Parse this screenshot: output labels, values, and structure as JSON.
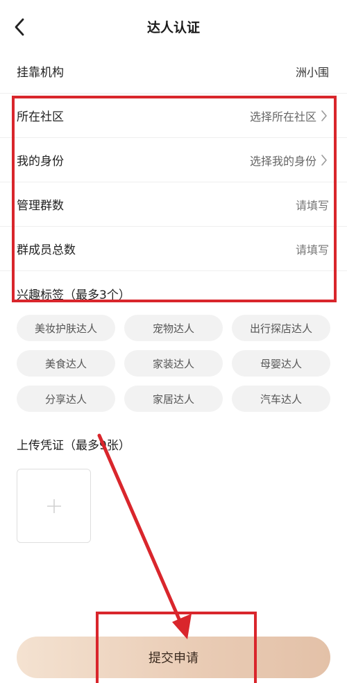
{
  "header": {
    "title": "达人认证",
    "back_icon": "chevron-left-icon"
  },
  "form": {
    "affiliation": {
      "label": "挂靠机构",
      "value": "洲小围"
    },
    "community": {
      "label": "所在社区",
      "value": "选择所在社区"
    },
    "identity": {
      "label": "我的身份",
      "value": "选择我的身份"
    },
    "groups_managed": {
      "label": "管理群数",
      "placeholder": "请填写"
    },
    "group_members": {
      "label": "群成员总数",
      "placeholder": "请填写"
    }
  },
  "interests": {
    "title": "兴趣标签（最多3个）",
    "tags": [
      "美妆护肤达人",
      "宠物达人",
      "出行探店达人",
      "美食达人",
      "家装达人",
      "母婴达人",
      "分享达人",
      "家居达人",
      "汽车达人"
    ]
  },
  "upload": {
    "title": "上传凭证（最多9张）",
    "add_icon": "plus-icon"
  },
  "submit": {
    "label": "提交申请"
  },
  "colors": {
    "annotation_red": "#d9262c",
    "submit_gradient_start": "#f4e2d1",
    "submit_gradient_end": "#e3c1a8"
  }
}
